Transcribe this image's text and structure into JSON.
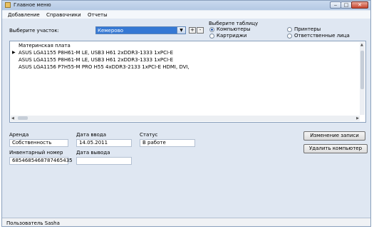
{
  "window": {
    "title": "Главное меню",
    "minimize": "‒",
    "maximize": "□",
    "close": "✕"
  },
  "menu": [
    "Добавление",
    "Справочники",
    "Отчеты"
  ],
  "site": {
    "label": "Выберите участок:",
    "value": "Кемерово",
    "add": "+",
    "remove": "-"
  },
  "table_select": {
    "label": "Выберите таблицу",
    "options": [
      {
        "label": "Компьютеры",
        "selected": true
      },
      {
        "label": "Принтеры",
        "selected": false
      },
      {
        "label": "Картриджи",
        "selected": false
      },
      {
        "label": "Ответственные лица",
        "selected": false
      }
    ]
  },
  "list": {
    "header": "Материнская плата",
    "rows": [
      "ASUS LGA1155 P8H61-M LE, USB3 H61 2xDDR3-1333 1xPCI-E",
      "ASUS LGA1155 P8H61-M LE, USB3 H61 2xDDR3-1333 1xPCI-E",
      "ASUS LGA1156 P7H55-M PRO H55 4xDDR3-2133 1xPCI-E HDMI, DVI,"
    ],
    "selected_row": 0
  },
  "details": {
    "lease_label": "Аренда",
    "lease_value": "Собственность",
    "date_in_label": "Дата ввода",
    "date_in_value": "14.05.2011",
    "status_label": "Статус",
    "status_value": "В работе",
    "inventory_label": "Инвентарный номер",
    "inventory_value": "6854685468787465435",
    "date_out_label": "Дата вывода",
    "date_out_value": ""
  },
  "buttons": {
    "edit": "Изменение записи",
    "delete": "Удалить компьютер"
  },
  "status": {
    "user": "Пользователь Sasha"
  }
}
